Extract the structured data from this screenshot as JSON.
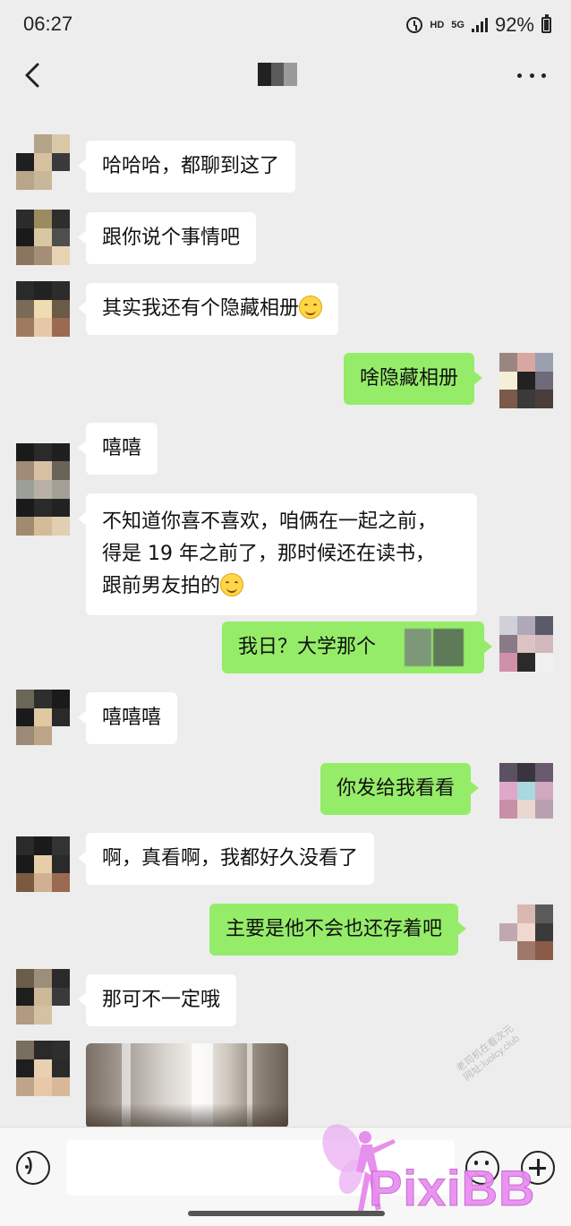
{
  "status_bar": {
    "time": "06:27",
    "network_hd": "HD",
    "network_5g": "5G",
    "battery": "92%"
  },
  "nav": {
    "title": ""
  },
  "messages": [
    {
      "side": "in",
      "text": "哈哈哈，都聊到这了"
    },
    {
      "side": "in",
      "text": "跟你说个事情吧"
    },
    {
      "side": "in",
      "text": "其实我还有个隐藏相册",
      "emoji": "smile"
    },
    {
      "side": "out",
      "text": "啥隐藏相册"
    },
    {
      "side": "in",
      "text": "嘻嘻"
    },
    {
      "side": "in",
      "lines": [
        "不知道你喜不喜欢，咱俩在一起之前，",
        "得是 19 年之前了，那时候还在读书，",
        "跟前男友拍的"
      ],
      "emoji": "smile"
    },
    {
      "side": "out",
      "text": "我日？大学那个"
    },
    {
      "side": "in",
      "text": "嘻嘻嘻"
    },
    {
      "side": "out",
      "text": "你发给我看看"
    },
    {
      "side": "in",
      "text": "啊，真看啊，我都好久没看了"
    },
    {
      "side": "out",
      "text": "主要是他不会也还存着吧"
    },
    {
      "side": "in",
      "text": "那可不一定哦"
    },
    {
      "side": "in",
      "type": "image"
    }
  ],
  "input_bar": {
    "placeholder": ""
  },
  "watermarks": {
    "logo_text": "PixiBB",
    "site_text_line1": "老司机在看次元",
    "site_text_line2": "网址:luolcy.club"
  },
  "colors": {
    "background": "#ededed",
    "incoming_bubble": "#ffffff",
    "outgoing_bubble": "#95ec69"
  }
}
